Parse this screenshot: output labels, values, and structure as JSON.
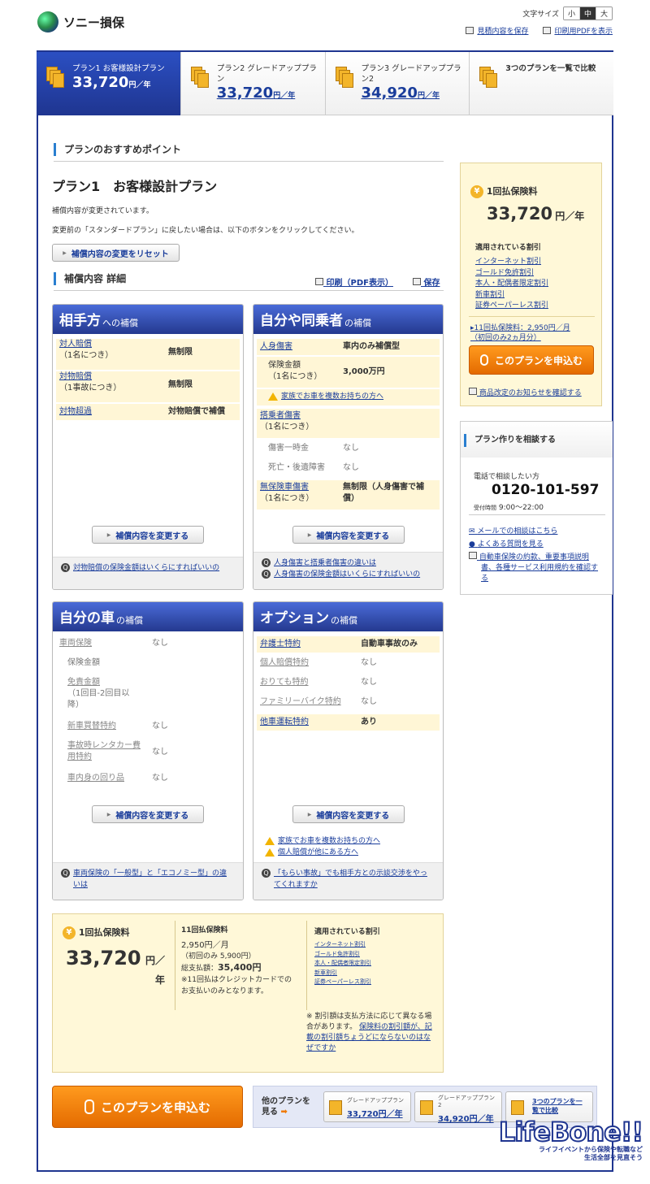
{
  "header": {
    "logo_text": "ソニー損保",
    "font_size_label": "文字サイズ",
    "font_sizes": [
      "小",
      "中",
      "大"
    ],
    "save_link": "見積内容を保存",
    "pdf_link": "印刷用PDFを表示"
  },
  "tabs": [
    {
      "name": "プラン1 お客様設計プラン",
      "price": "33,720",
      "unit": "円／年"
    },
    {
      "name": "プラン2 グレードアッププラン",
      "price": "33,720",
      "unit": "円／年"
    },
    {
      "name": "プラン3 グレードアッププラン2",
      "price": "34,920",
      "unit": "円／年"
    },
    {
      "name": "3つのプランを一覧で比較"
    }
  ],
  "main": {
    "recommend_heading": "プランのおすすめポイント",
    "plan_title": "プラン1　お客様設計プラン",
    "changed_note": "補償内容が変更されています。",
    "revert_note": "変更前の「スタンダードプラン」に戻したい場合は、以下のボタンをクリックしてください。",
    "reset_button": "補償内容の変更をリセット",
    "detail_heading": "補償内容 詳細",
    "print_link": "印刷（PDF表示）",
    "save_link": "保存",
    "change_button": "補償内容を変更する"
  },
  "panels": {
    "p1": {
      "title_big": "相手方",
      "title_small": "への補償",
      "rows": [
        {
          "k": "対人賠償",
          "k2": "（1名につき）",
          "v": "無制限"
        },
        {
          "k": "対物賠償",
          "k2": "（1事故につき）",
          "v": "無制限"
        },
        {
          "k": "対物超過",
          "v": "対物賠償で補償"
        }
      ],
      "faq": [
        "対物賠償の保険金額はいくらにすればいいの"
      ]
    },
    "p2": {
      "title_big": "自分や同乗者",
      "title_small": "の補償",
      "r1k": "人身傷害",
      "r1v": "車内のみ補償型",
      "r2k": "保険金額",
      "r2k2": "（1名につき）",
      "r2v": "3,000万円",
      "warn": "家族でお車を複数お持ちの方へ",
      "r3k": "搭乗者傷害",
      "r3k2": "（1名につき）",
      "r4k": "傷害一時金",
      "r4v": "なし",
      "r5k": "死亡・後遺障害",
      "r5v": "なし",
      "r6k": "無保険車傷害",
      "r6k2": "（1名につき）",
      "r6v": "無制限（人身傷害で補",
      "r6v2": "償）",
      "faq": [
        "人身傷害と搭乗者傷害の違いは",
        "人身傷害の保険金額はいくらにすればいいの"
      ]
    },
    "p3": {
      "title_big": "自分の車",
      "title_small": "の補償",
      "r1k": "車両保険",
      "r1v": "なし",
      "r2k": "保険金額",
      "r3k": "免責金額",
      "r3k2": "（1回目-2回目以",
      "r3k3": "降）",
      "r4k": "新車買替特約",
      "r4v": "なし",
      "r5k": "事故時レンタカー費",
      "r5k2": "用特約",
      "r5v": "なし",
      "r6k": "車内身の回り品",
      "r6v": "なし",
      "faq1": "車両保険の「一般型」と「エコノミー型」の違",
      "faq2": "いは"
    },
    "p4": {
      "title_big": "オプション",
      "title_small": "の補償",
      "rows": [
        {
          "k": "弁護士特約",
          "v": "自動車事故のみ"
        },
        {
          "k": "個人賠償特約",
          "v": "なし"
        },
        {
          "k": "おりても特約",
          "v": "なし"
        },
        {
          "k": "ファミリーバイク特約",
          "v": "なし"
        },
        {
          "k": "他車運転特約",
          "v": "あり"
        }
      ],
      "warn1": "家族でお車を複数お持ちの方へ",
      "warn2": "個人賠償が他にある方へ",
      "faq1": "「もらい事故」でも相手方との示談交渉をやっ",
      "faq2": "てくれますか"
    }
  },
  "sidebar": {
    "lump_label": "1回払保険料",
    "lump_price": "33,720",
    "lump_unit": "円／年",
    "discount_heading": "適用されている割引",
    "discounts": [
      "インターネット割引",
      "ゴールド免許割引",
      "本人・配偶者限定割引",
      "新車割引",
      "証券ペーパーレス割引"
    ],
    "install": "11回払保険料：2,950円／月",
    "install2": "（初回のみ2ヵ月分）",
    "apply_button": "このプランを申込む",
    "notice": "商品改定のお知らせを確認する",
    "consult_heading": "プラン作りを相談する",
    "phone_label": "電話で相談したい方",
    "phone": "0120-101-597",
    "hours_label": "受付時間",
    "hours": "9:00～22:00",
    "links": [
      "メールでの相談はこちら",
      "よくある質問を見る",
      "自動車保険の約款、重要事項説明",
      "書、各種サービス利用規約を確認す",
      "る"
    ]
  },
  "bottom": {
    "lump_label": "1回払保険料",
    "lump_price": "33,720",
    "lump_unit1": "円／",
    "lump_unit2": "年",
    "inst_label": "11回払保険料",
    "inst_month": "2,950円／月",
    "inst_first": "（初回のみ 5,900円）",
    "inst_total_label": "総支払額：",
    "inst_total": "35,400円",
    "inst_note1": "※11回払はクレジットカードでの",
    "inst_note2": "お支払いのみとなります。",
    "discount_heading": "適用されている割引",
    "discounts": [
      "インターネット割引",
      "ゴールド免許割引",
      "本人・配偶者限定割引",
      "新車割引",
      "証券ペーパーレス割引"
    ],
    "note1": "※ 割引額は支払方法に応じて異なる場",
    "note2": "合があります。",
    "note_link1": "保険料の割引額が、記",
    "note_link2": "載の割引額ちょうどにならないのはな",
    "note_link3": "ぜですか",
    "apply_button": "このプランを申込む",
    "other_label1": "他のプランを",
    "other_label2": "見る",
    "other": [
      {
        "name": "グレードアッププラン",
        "price": "33,720円／年"
      },
      {
        "name": "グレードアッププラン",
        "name2": "2",
        "price": "34,920円／年"
      },
      {
        "name": "3つのプランを一",
        "name2": "覧で比較"
      }
    ]
  },
  "watermark": {
    "brand": "LifeBone!!",
    "tagline1": "ライフイベントから保険や転職など",
    "tagline2": "生活全部を見直そう"
  }
}
